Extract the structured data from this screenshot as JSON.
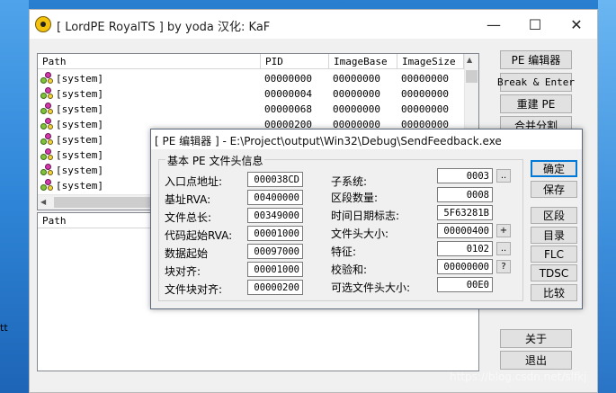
{
  "desktop": {
    "left_text": "tt",
    "watermark": "https://blog.csdn.net/slfkj"
  },
  "window": {
    "title": "[ LordPE RoyalTS ] by yoda 汉化: KaF",
    "min": "—",
    "max": "☐",
    "close": "✕"
  },
  "process_list": {
    "headers": [
      "Path",
      "PID",
      "ImageBase",
      "ImageSize"
    ],
    "rows": [
      {
        "path": "[system]",
        "pid": "00000000",
        "base": "00000000",
        "size": "00000000"
      },
      {
        "path": "[system]",
        "pid": "00000004",
        "base": "00000000",
        "size": "00000000"
      },
      {
        "path": "[system]",
        "pid": "00000068",
        "base": "00000000",
        "size": "00000000"
      },
      {
        "path": "[system]",
        "pid": "00000200",
        "base": "00000000",
        "size": "00000000"
      },
      {
        "path": "[system]",
        "pid": "",
        "base": "",
        "size": ""
      },
      {
        "path": "[system]",
        "pid": "",
        "base": "",
        "size": ""
      },
      {
        "path": "[system]",
        "pid": "",
        "base": "",
        "size": ""
      },
      {
        "path": "[system]",
        "pid": "",
        "base": "",
        "size": ""
      }
    ]
  },
  "module_list": {
    "header_path": "Path"
  },
  "right_buttons": {
    "pe_editor": "PE 编辑器",
    "break_enter": "Break & Enter",
    "rebuild_pe": "重建 PE",
    "merge_split": "合并分割",
    "about": "关于",
    "exit": "退出"
  },
  "dialog": {
    "title": "[ PE 编辑器 ] - E:\\Project\\output\\Win32\\Debug\\SendFeedback.exe",
    "group_title": "基本 PE 文件头信息",
    "left_fields": [
      {
        "label": "入口点地址:",
        "value": "000038CD"
      },
      {
        "label": "基址RVA:",
        "value": "00400000"
      },
      {
        "label": "文件总长:",
        "value": "00349000"
      },
      {
        "label": "代码起始RVA:",
        "value": "00001000"
      },
      {
        "label": "数据起始",
        "value": "00097000"
      },
      {
        "label": "块对齐:",
        "value": "00001000"
      },
      {
        "label": "文件块对齐:",
        "value": "00000200"
      }
    ],
    "right_fields": [
      {
        "label": "子系统:",
        "value": "0003",
        "btn": ".."
      },
      {
        "label": "区段数量:",
        "value": "0008",
        "btn": ""
      },
      {
        "label": "时间日期标志:",
        "value": "5F63281B",
        "btn": ""
      },
      {
        "label": "文件头大小:",
        "value": "00000400",
        "btn": "+"
      },
      {
        "label": "特征:",
        "value": "0102",
        "btn": ".."
      },
      {
        "label": "校验和:",
        "value": "00000000",
        "btn": "?"
      },
      {
        "label": "可选文件头大小:",
        "value": "00E0",
        "btn": ""
      }
    ],
    "buttons": {
      "ok": "确定",
      "save": "保存",
      "sections": "区段",
      "directories": "目录",
      "flc": "FLC",
      "tdsc": "TDSC",
      "compare": "比较"
    }
  }
}
